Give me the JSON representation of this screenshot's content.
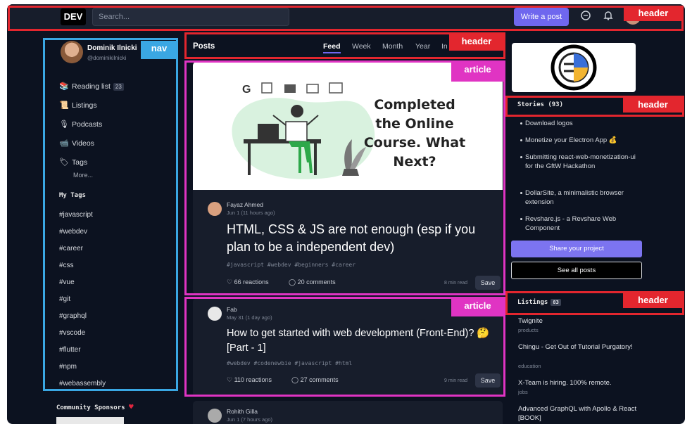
{
  "topbar": {
    "logo": "DEV",
    "search_placeholder": "Search...",
    "write_button": "Write a post",
    "icons": [
      "chat-icon",
      "bell-icon"
    ]
  },
  "nav": {
    "user_name": "Dominik Ilnicki",
    "user_handle": "@dominikilnicki",
    "items": [
      {
        "label": "Reading list",
        "icon": "books-icon",
        "count": "23"
      },
      {
        "label": "Listings",
        "icon": "scroll-icon"
      },
      {
        "label": "Podcasts",
        "icon": "microphone-icon"
      },
      {
        "label": "Videos",
        "icon": "camera-icon"
      },
      {
        "label": "Tags",
        "icon": "tag-icon"
      }
    ],
    "more": "More...",
    "my_tags_title": "My Tags",
    "tags": [
      "#javascript",
      "#webdev",
      "#career",
      "#css",
      "#vue",
      "#git",
      "#graphql",
      "#vscode",
      "#flutter",
      "#npm",
      "#webassembly"
    ],
    "sponsors_title": "Community Sponsors"
  },
  "posts": {
    "title": "Posts",
    "tabs": [
      "Feed",
      "Week",
      "Month",
      "Year",
      "Infinity"
    ],
    "active_tab": "Feed"
  },
  "articles": [
    {
      "cover_text": "Completed the Online Course. What Next?",
      "author": "Fayaz Ahmed",
      "date": "Jun 1 (11 hours ago)",
      "title": "HTML, CSS & JS are not enough (esp if you plan to be a independent dev)",
      "tags": "#javascript #webdev #beginners #career",
      "reactions": "66 reactions",
      "comments": "20 comments",
      "read_time": "8 min read",
      "save": "Save"
    },
    {
      "author": "Fab",
      "date": "May 31 (1 day ago)",
      "title": "How to get started with web development (Front-End)? 🤔 [Part - 1]",
      "tags": "#webdev #codenewbie #javascript #html",
      "reactions": "110 reactions",
      "comments": "27 comments",
      "read_time": "9 min read",
      "save": "Save"
    },
    {
      "author": "Rohith Gilla",
      "date": "Jun 1 (7 hours ago)"
    }
  ],
  "sidebar_right": {
    "stories_title": "Stories (93)",
    "stories": [
      "Download logos",
      "Monetize your Electron App 💰",
      "Submitting react-web-monetization-ui for the GftW Hackathon",
      "DollarSite, a minimalistic browser extension",
      "Revshare.js - a Revshare Web Component"
    ],
    "share_button": "Share your project",
    "see_all_button": "See all posts",
    "listings_title": "Listings",
    "listings_count": "83",
    "listings": [
      {
        "title": "Twignite",
        "category": "products"
      },
      {
        "title": "Chingu - Get Out of Tutorial Purgatory!",
        "category": "education"
      },
      {
        "title": "X-Team is hiring. 100% remote.",
        "category": "jobs"
      },
      {
        "title": "Advanced GraphQL with Apollo & React [BOOK]",
        "category": ""
      }
    ]
  },
  "annotations": {
    "header": "header",
    "nav": "nav",
    "article": "article"
  },
  "colors": {
    "annotation_header": "#e3262e",
    "annotation_nav": "#3aa7e3",
    "annotation_article": "#e034c3",
    "accent": "#6f67ee"
  }
}
